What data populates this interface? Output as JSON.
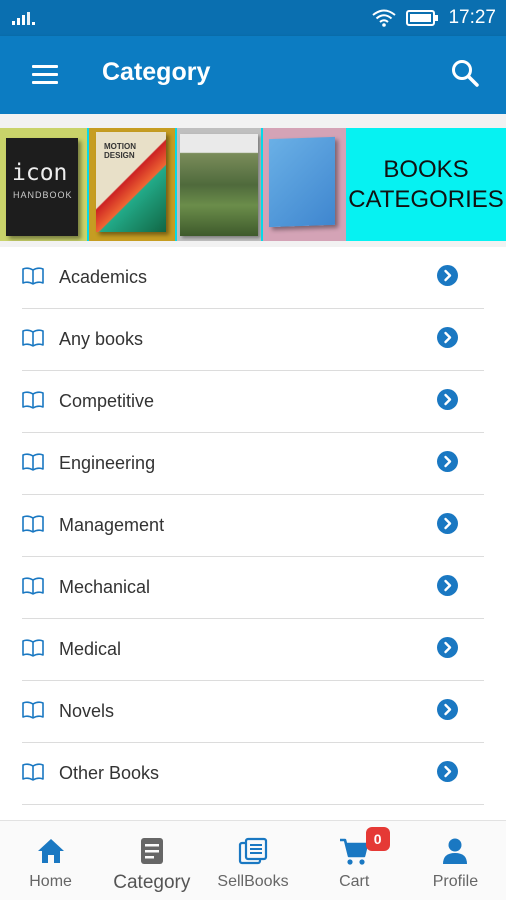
{
  "status_bar": {
    "time": "17:27"
  },
  "app_bar": {
    "title": "Category"
  },
  "banner": {
    "line1": "BOOKS",
    "line2": "CATEGORIES",
    "book1_title": "icon",
    "book1_subtitle": "HANDBOOK",
    "book2_title": "MOTION DESIGN",
    "bg_color": "#06f2f2"
  },
  "categories": [
    {
      "label": "Academics"
    },
    {
      "label": "Any books"
    },
    {
      "label": "Competitive"
    },
    {
      "label": "Engineering"
    },
    {
      "label": "Management"
    },
    {
      "label": "Mechanical"
    },
    {
      "label": "Medical"
    },
    {
      "label": "Novels"
    },
    {
      "label": "Other Books"
    }
  ],
  "bottom_nav": {
    "items": [
      {
        "label": "Home",
        "icon": "home-icon"
      },
      {
        "label": "Category",
        "icon": "category-icon"
      },
      {
        "label": "SellBooks",
        "icon": "sellbooks-icon"
      },
      {
        "label": "Cart",
        "icon": "cart-icon",
        "badge": "0"
      },
      {
        "label": "Profile",
        "icon": "profile-icon"
      }
    ],
    "active_index": 1
  },
  "colors": {
    "primary": "#0c7cc2",
    "status_bar": "#0a6fb0",
    "accent_chevron": "#1a78c2",
    "badge": "#e53935"
  }
}
